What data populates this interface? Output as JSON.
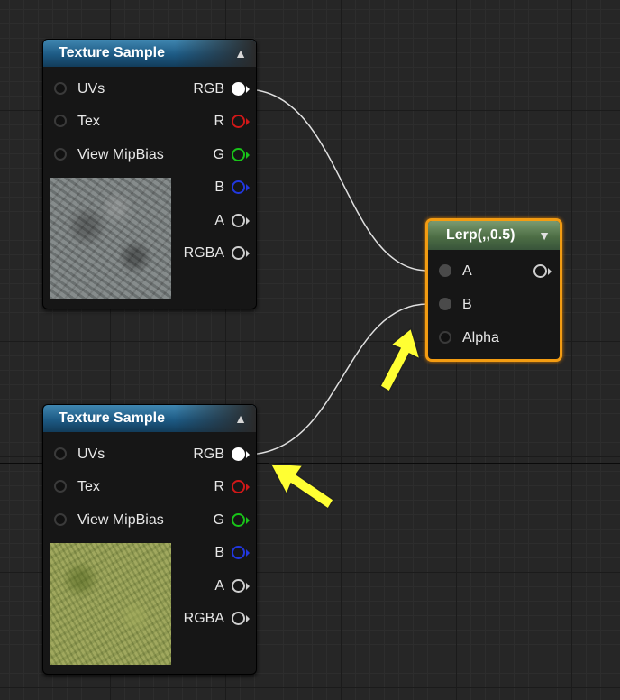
{
  "nodes": {
    "texture_sample_1": {
      "title": "Texture Sample",
      "inputs": [
        "UVs",
        "Tex",
        "View MipBias"
      ],
      "outputs": [
        "RGB",
        "R",
        "G",
        "B",
        "A",
        "RGBA"
      ],
      "thumbnail": "rock-texture"
    },
    "texture_sample_2": {
      "title": "Texture Sample",
      "inputs": [
        "UVs",
        "Tex",
        "View MipBias"
      ],
      "outputs": [
        "RGB",
        "R",
        "G",
        "B",
        "A",
        "RGBA"
      ],
      "thumbnail": "grass-texture"
    },
    "lerp": {
      "title": "Lerp(,,0.5)",
      "inputs": [
        "A",
        "B",
        "Alpha"
      ]
    }
  },
  "colors": {
    "background": "#262626",
    "texture_header": "#1d5a84",
    "lerp_header": "#4d6e45",
    "selection": "#f39c12",
    "wire": "#e0e0e0",
    "arrow": "#ffff33",
    "pin_r": "#d01818",
    "pin_g": "#19c419",
    "pin_b": "#2238e0"
  },
  "icons": [
    "collapse-up-icon",
    "collapse-down-icon",
    "pin-icon",
    "arrow-pointer-icon"
  ]
}
